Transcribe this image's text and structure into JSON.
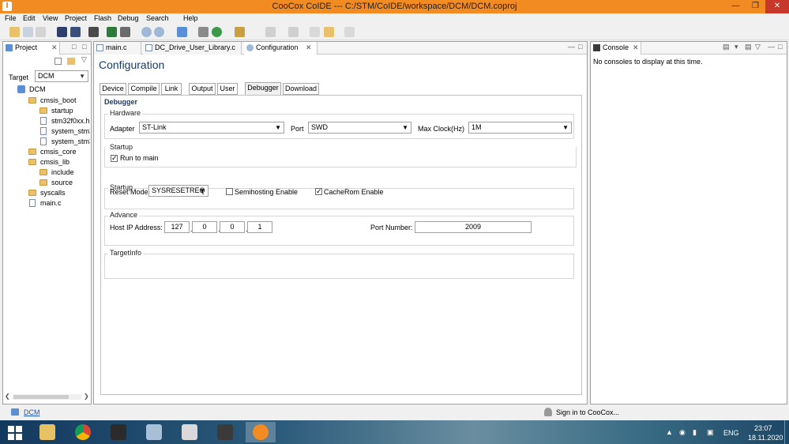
{
  "window": {
    "title": "CooCox CoIDE --- C:/STM/CoIDE/workspace/DCM/DCM.coproj",
    "app_icon_letter": "I"
  },
  "menu": [
    "File",
    "Edit",
    "View",
    "Project",
    "Flash",
    "Debug",
    "Search",
    "Help"
  ],
  "project_view": {
    "tab_label": "Project",
    "target_label": "Target",
    "target_value": "DCM",
    "tree": [
      {
        "label": "DCM",
        "kind": "project"
      },
      {
        "label": "cmsis_boot",
        "kind": "folder"
      },
      {
        "label": "startup",
        "kind": "folder"
      },
      {
        "label": "stm32f0xx.h",
        "kind": "file"
      },
      {
        "label": "system_stm3",
        "kind": "file"
      },
      {
        "label": "system_stm3",
        "kind": "file"
      },
      {
        "label": "cmsis_core",
        "kind": "folder"
      },
      {
        "label": "cmsis_lib",
        "kind": "folder"
      },
      {
        "label": "include",
        "kind": "folder"
      },
      {
        "label": "source",
        "kind": "folder"
      },
      {
        "label": "syscalls",
        "kind": "folder"
      },
      {
        "label": "main.c",
        "kind": "file"
      }
    ]
  },
  "editor_tabs": [
    {
      "label": "main.c"
    },
    {
      "label": "DC_Drive_User_Library.c"
    },
    {
      "label": "Configuration",
      "active": true
    }
  ],
  "configuration": {
    "title": "Configuration",
    "tabs": [
      "Device",
      "Compile",
      "Link",
      "Output",
      "User",
      "Debugger",
      "Download"
    ],
    "active_tab": "Debugger",
    "section_title": "Debugger",
    "hardware": {
      "group_label": "Hardware",
      "adapter_label": "Adapter",
      "adapter_value": "ST-Link",
      "port_label": "Port",
      "port_value": "SWD",
      "maxclock_label": "Max Clock(Hz)",
      "maxclock_value": "1M"
    },
    "startup": {
      "group_label": "Startup",
      "run_to_main_label": "Run to main",
      "run_to_main_checked": true
    },
    "advance": {
      "group_label": "Advance",
      "reset_mode_label": "Reset Mode",
      "reset_mode_value": "SYSRESETREQ",
      "semihosting_label": "Semihosting Enable",
      "semihosting_checked": false,
      "cacherom_label": "CacheRom Enable",
      "cacherom_checked": true
    },
    "target_info": {
      "group_label": "TargetInfo",
      "host_ip_label": "Host IP Address:",
      "ip_octets": [
        "127",
        "0",
        "0",
        "1"
      ],
      "port_number_label": "Port Number:",
      "port_number_value": "2009"
    }
  },
  "console": {
    "tab_label": "Console",
    "message": "No consoles to display at this time."
  },
  "status_bar": {
    "project_link": "DCM",
    "sign_in": "Sign in to CooCox..."
  },
  "taskbar": {
    "language": "ENG",
    "time": "23:07",
    "date": "18.11.2020"
  },
  "colors": {
    "titlebar": "#f28b22",
    "close_button": "#c8372c",
    "heading_blue": "#1a3a6b"
  }
}
